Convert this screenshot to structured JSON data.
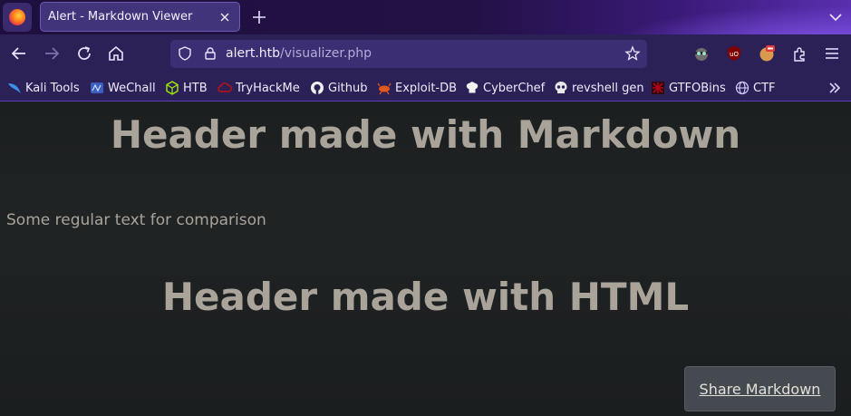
{
  "browser": {
    "tab": {
      "title": "Alert - Markdown Viewer"
    },
    "url": {
      "host": "alert.htb",
      "path": "/visualizer.php"
    },
    "icons": [
      "firefox-logo",
      "close-icon",
      "plus-icon",
      "chevron-down-icon",
      "back-arrow-icon",
      "forward-arrow-icon",
      "reload-icon",
      "home-icon",
      "shield-icon",
      "lock-icon",
      "star-icon",
      "extensions-icon",
      "hamburger-menu-icon"
    ],
    "colors": {
      "tabstrip": "#221144",
      "toolbar": "#2b2156",
      "urlbar": "#3b2e72",
      "accent": "#5e3fb8"
    }
  },
  "bookmarks": [
    {
      "label": "Kali Tools",
      "icon": "kali-dragon-icon",
      "color": "#3b8fe6"
    },
    {
      "label": "WeChall",
      "icon": "wechall-icon",
      "color": "#5a7fd6"
    },
    {
      "label": "HTB",
      "icon": "htb-cube-icon",
      "color": "#9fef00"
    },
    {
      "label": "TryHackMe",
      "icon": "tryhackme-cloud-icon",
      "color": "#c11111"
    },
    {
      "label": "Github",
      "icon": "github-icon",
      "color": "#f0f0f0"
    },
    {
      "label": "Exploit-DB",
      "icon": "exploitdb-bug-icon",
      "color": "#e2571e"
    },
    {
      "label": "CyberChef",
      "icon": "chef-hat-icon",
      "color": "#f2f2f2"
    },
    {
      "label": "revshell gen",
      "icon": "skull-icon",
      "color": "#e8e8e8"
    },
    {
      "label": "GTFOBins",
      "icon": "gtfobins-icon",
      "color": "#b3001b"
    },
    {
      "label": "CTF",
      "icon": "globe-icon",
      "color": "#d7cfff"
    }
  ],
  "page": {
    "heading_markdown": "Header made with Markdown",
    "paragraph": "Some regular text for comparison",
    "heading_html": "Header made with HTML",
    "share_button": "Share Markdown",
    "colors": {
      "background": "#1c1f20",
      "text": "#a9a39a",
      "button": "#444a4f"
    }
  }
}
